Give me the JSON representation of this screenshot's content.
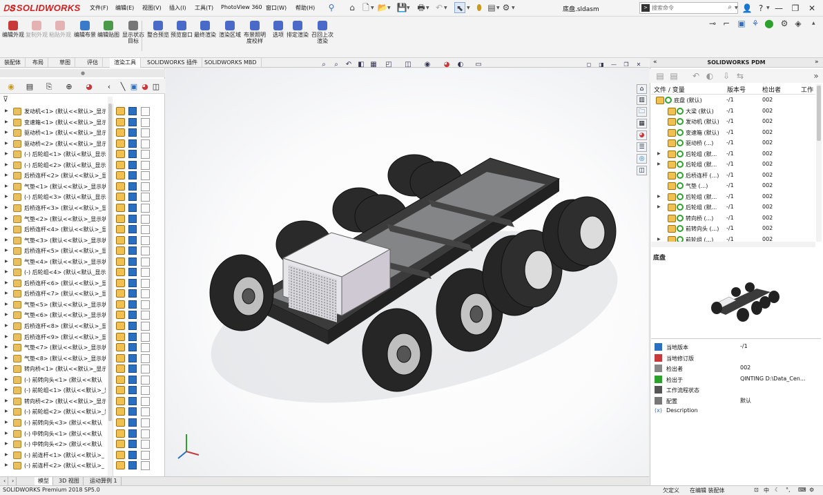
{
  "app": {
    "name": "SOLIDWORKS",
    "document_title": "底盘.sldasm"
  },
  "menu": [
    "文件(F)",
    "编辑(E)",
    "视图(V)",
    "插入(I)",
    "工具(T)",
    "PhotoView 360",
    "窗口(W)",
    "帮助(H)"
  ],
  "search": {
    "placeholder": "搜索命令"
  },
  "window_controls": [
    "?",
    "—",
    "❐",
    "✕"
  ],
  "commands": [
    {
      "label": "编辑外观",
      "disabled": false,
      "color": "#c83a3a"
    },
    {
      "label": "复制外观",
      "disabled": true,
      "color": "#c83a3a"
    },
    {
      "label": "粘贴外观",
      "disabled": true,
      "color": "#c83a3a"
    },
    {
      "label": "编辑布景",
      "disabled": false,
      "color": "#3a7ac8"
    },
    {
      "label": "编辑贴图",
      "disabled": false,
      "color": "#4a9a4a"
    },
    {
      "label": "显示状态目标",
      "disabled": false,
      "color": "#777777"
    },
    {
      "label": "整合预览",
      "disabled": false,
      "color": "#4a6ac8"
    },
    {
      "label": "预览窗口",
      "disabled": false,
      "color": "#4a6ac8"
    },
    {
      "label": "最终渲染",
      "disabled": false,
      "color": "#4a6ac8"
    },
    {
      "label": "渲染区域",
      "disabled": false,
      "color": "#4a6ac8"
    },
    {
      "label": "布景照明度校样",
      "disabled": false,
      "color": "#4a6ac8"
    },
    {
      "label": "选项",
      "disabled": false,
      "color": "#4a6ac8"
    },
    {
      "label": "排定渲染",
      "disabled": false,
      "color": "#4a6ac8"
    },
    {
      "label": "召回上次渲染",
      "disabled": false,
      "color": "#4a6ac8"
    }
  ],
  "tabs": [
    {
      "label": "装配体",
      "active": false
    },
    {
      "label": "布局",
      "active": false
    },
    {
      "label": "草图",
      "active": false
    },
    {
      "label": "评估",
      "active": false
    },
    {
      "label": "渲染工具",
      "active": true
    },
    {
      "label": "SOLIDWORKS 插件",
      "active": false
    },
    {
      "label": "SOLIDWORKS MBD",
      "active": false
    }
  ],
  "tree_items": [
    "发动机<1> (默认<<默认>_显示",
    "变速箱<1> (默认<<默认>_显示",
    "驱动桥<1> (默认<<默认>_显示",
    "驱动桥<2> (默认<<默认>_显示",
    "(-) 后轮组<1> (默认<默认_显示",
    "(-) 后轮组<2> (默认<默认_显示",
    "后桥连杆<2> (默认<<默认>_显",
    "气垫<1> (默认<<默认>_显示状",
    "(-) 后轮组<3> (默认<默认_显示",
    "后桥连杆<3> (默认<<默认>_显",
    "气垫<2> (默认<<默认>_显示状",
    "后桥连杆<4> (默认<<默认>_显",
    "气垫<3> (默认<<默认>_显示状",
    "后桥连杆<5> (默认<<默认>_显",
    "气垫<4> (默认<<默认>_显示状",
    "(-) 后轮组<4> (默认<默认_显示",
    "后桥连杆<6> (默认<<默认>_显",
    "后桥连杆<7> (默认<<默认>_显",
    "气垫<5> (默认<<默认>_显示状",
    "气垫<6> (默认<<默认>_显示状",
    "后桥连杆<8> (默认<<默认>_显",
    "后桥连杆<9> (默认<<默认>_显",
    "气垫<7> (默认<<默认>_显示状",
    "气垫<8> (默认<<默认>_显示状",
    "转向桥<1> (默认<<默认>_显示",
    "(-) 前转向头<1> (默认<<默认",
    "(-) 前轮组<1> (默认<<默认>_显",
    "转向桥<2> (默认<<默认>_显示",
    "(-) 前轮组<2> (默认<<默认>_显",
    "(-) 前转向头<3> (默认<<默认",
    "(-) 中转向头<1> (默认<<默认",
    "(-) 中转向头<2> (默认<<默认",
    "(-) 前连杆<1> (默认<<默认>_",
    "(-) 前连杆<2> (默认<<默认>_"
  ],
  "bottom_tabs": [
    "模型",
    "3D 视图",
    "运动算例 1"
  ],
  "status": {
    "version": "SOLIDWORKS Premium 2018 SP5.0",
    "custom": "欠定义",
    "mode": "在编辑 装配体"
  },
  "pdm": {
    "header": "SOLIDWORKS PDM",
    "columns": [
      "文件 / 变量",
      "版本号",
      "检出者",
      "工作"
    ],
    "rows": [
      {
        "name": "底盘 (默认)",
        "version": "-/1",
        "checked": "002",
        "indent": 0,
        "expand": false
      },
      {
        "name": "大梁 (默认)",
        "version": "-/1",
        "checked": "002",
        "indent": 1,
        "expand": false
      },
      {
        "name": "发动机 (默认)",
        "version": "-/1",
        "checked": "002",
        "indent": 1,
        "expand": false
      },
      {
        "name": "变速箱 (默认)",
        "version": "-/1",
        "checked": "002",
        "indent": 1,
        "expand": false
      },
      {
        "name": "驱动桥 (...)",
        "version": "-/1",
        "checked": "002",
        "indent": 1,
        "expand": false
      },
      {
        "name": "后轮组 (默...",
        "version": "-/1",
        "checked": "002",
        "indent": 1,
        "expand": true
      },
      {
        "name": "后轮组 (默...",
        "version": "-/1",
        "checked": "002",
        "indent": 1,
        "expand": true
      },
      {
        "name": "后桥连杆 (...)",
        "version": "-/1",
        "checked": "002",
        "indent": 1,
        "expand": false
      },
      {
        "name": "气垫 (...)",
        "version": "-/1",
        "checked": "002",
        "indent": 1,
        "expand": false
      },
      {
        "name": "后轮组 (默...",
        "version": "-/1",
        "checked": "002",
        "indent": 1,
        "expand": true
      },
      {
        "name": "后轮组 (默...",
        "version": "-/1",
        "checked": "002",
        "indent": 1,
        "expand": true
      },
      {
        "name": "转向桥 (...)",
        "version": "-/1",
        "checked": "002",
        "indent": 1,
        "expand": false
      },
      {
        "name": "前转向头 (...)",
        "version": "-/1",
        "checked": "002",
        "indent": 1,
        "expand": false
      },
      {
        "name": "前轮组 (...)",
        "version": "-/1",
        "checked": "002",
        "indent": 1,
        "expand": true
      }
    ],
    "preview_label": "底盘",
    "properties": [
      {
        "label": "当地版本",
        "value": "-/1",
        "icon_color": "#2a6fc0"
      },
      {
        "label": "当地修订版",
        "value": "",
        "icon_color": "#c83a3a"
      },
      {
        "label": "检出者",
        "value": "002",
        "icon_color": "#888888"
      },
      {
        "label": "检出于",
        "value": "QINTING   D:\\Data_Cen...",
        "icon_color": "#2da02d"
      },
      {
        "label": "工作流程状态",
        "value": "",
        "icon_color": "#555555"
      },
      {
        "label": "配置",
        "value": "默认",
        "icon_color": "#777777"
      },
      {
        "label": "Description",
        "value": "",
        "icon_color": "#2a6fc0",
        "prefix": "(x)"
      }
    ]
  },
  "colors": {
    "accent": "#d21f1f",
    "pdm_green": "#2da02d",
    "tree_blue": "#2a6fc0"
  },
  "icons": [
    "home-icon",
    "new-file-icon",
    "open-icon",
    "save-icon",
    "print-icon",
    "undo-icon",
    "select-icon",
    "rebuild-icon",
    "options-icon",
    "search-icon",
    "help-icon",
    "pin-icon"
  ]
}
